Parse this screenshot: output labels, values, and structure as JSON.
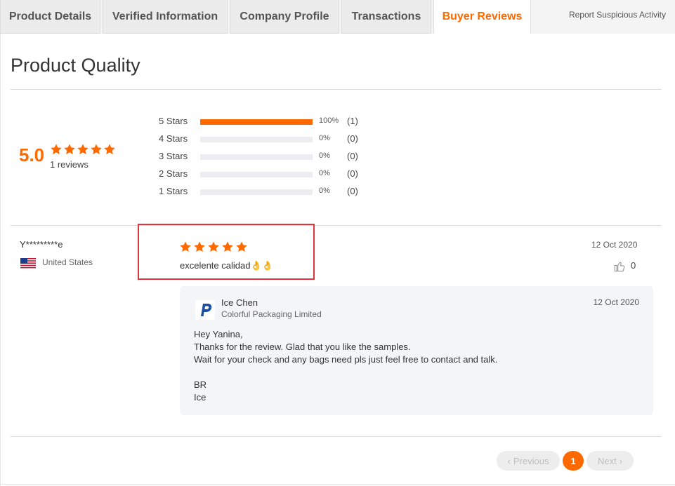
{
  "tabs": [
    {
      "label": "Product Details",
      "active": false
    },
    {
      "label": "Verified Information",
      "active": false
    },
    {
      "label": "Company Profile",
      "active": false
    },
    {
      "label": "Transactions",
      "active": false
    },
    {
      "label": "Buyer Reviews",
      "active": true
    }
  ],
  "report_link": "Report Suspicious Activity",
  "section_title": "Product Quality",
  "summary": {
    "score": "5.0",
    "stars": 5,
    "count_label": "1 reviews",
    "distribution": [
      {
        "label": "5 Stars",
        "fraction": 1.0,
        "pct": "100%",
        "count": "(1)"
      },
      {
        "label": "4 Stars",
        "fraction": 0.0,
        "pct": "0%",
        "count": "(0)"
      },
      {
        "label": "3 Stars",
        "fraction": 0.0,
        "pct": "0%",
        "count": "(0)"
      },
      {
        "label": "2 Stars",
        "fraction": 0.0,
        "pct": "0%",
        "count": "(0)"
      },
      {
        "label": "1 Stars",
        "fraction": 0.0,
        "pct": "0%",
        "count": "(0)"
      }
    ]
  },
  "review": {
    "reviewer": "Y*********e",
    "country": "United States",
    "rating": 5,
    "text": "excelente calidad👌👌",
    "date": "12 Oct 2020",
    "likes": "0"
  },
  "reply": {
    "name": "Ice Chen",
    "company": "Colorful Packaging Limited",
    "date": "12 Oct 2020",
    "lines": [
      "Hey Yanina,",
      "Thanks for the review. Glad that you like the samples.",
      "Wait for your check and any bags need pls just feel free to contact and talk.",
      "",
      "BR",
      "Ice"
    ]
  },
  "pagination": {
    "previous": "Previous",
    "current": "1",
    "next": "Next"
  },
  "colors": {
    "accent": "#ff6a00",
    "highlight": "#d9363e"
  }
}
